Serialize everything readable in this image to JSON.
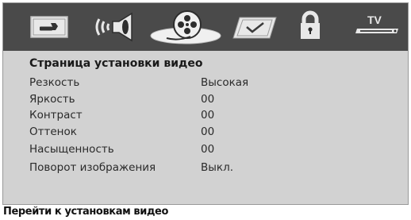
{
  "tabs": [
    {
      "icon": "wrench-icon"
    },
    {
      "icon": "speaker-icon"
    },
    {
      "icon": "film-reel-icon",
      "selected": true
    },
    {
      "icon": "checkmark-icon"
    },
    {
      "icon": "padlock-icon"
    },
    {
      "icon": "tv-icon",
      "label": "TV"
    }
  ],
  "page_title": "Страница установки видео",
  "settings": [
    {
      "label": "Резкость",
      "value": "Высокая"
    },
    {
      "label": "Яркость",
      "value": "00"
    },
    {
      "label": "Контраст",
      "value": "00"
    },
    {
      "label": "Оттенок",
      "value": "00"
    },
    {
      "label": "Насыщенность",
      "value": "00"
    },
    {
      "label": "Поворот изображения",
      "value": "Выкл."
    }
  ],
  "status_text": "Перейти к установкам видео",
  "colors": {
    "tab_bar": "#4a4a4a",
    "menu_background": "#d2d2d2",
    "icon_fill": "#e6e6e6",
    "text": "#2a2a2a"
  }
}
